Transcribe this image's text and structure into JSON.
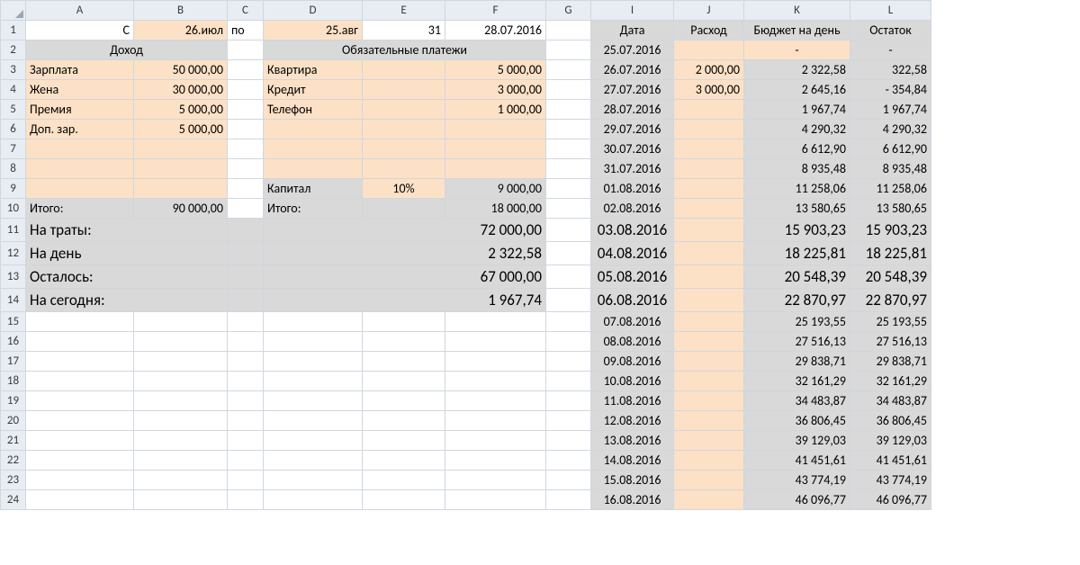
{
  "columns": [
    "A",
    "B",
    "C",
    "D",
    "E",
    "F",
    "G",
    "I",
    "J",
    "K",
    "L"
  ],
  "header": {
    "c_label": "С",
    "po_label": "по",
    "start_date": "26.июл",
    "end_date": "25.авг",
    "days": "31",
    "today": "28.07.2016",
    "date": "Дата",
    "expense": "Расход",
    "budget": "Бюджет на день",
    "balance": "Остаток"
  },
  "sections": {
    "income": "Доход",
    "payments": "Обязательные платежи"
  },
  "income": [
    {
      "name": "Зарплата",
      "value": "50 000,00"
    },
    {
      "name": "Жена",
      "value": "30 000,00"
    },
    {
      "name": "Премия",
      "value": "5 000,00"
    },
    {
      "name": "Доп. зар.",
      "value": "5 000,00"
    }
  ],
  "income_total": {
    "label": "Итого:",
    "value": "90 000,00"
  },
  "payments": [
    {
      "name": "Квартира",
      "value": "5 000,00"
    },
    {
      "name": "Кредит",
      "value": "3 000,00"
    },
    {
      "name": "Телефон",
      "value": "1 000,00"
    }
  ],
  "capital": {
    "name": "Капитал",
    "pct": "10%",
    "value": "9 000,00"
  },
  "payments_total": {
    "label": "Итого:",
    "value": "18 000,00"
  },
  "summary": [
    {
      "label": "На траты:",
      "value": "72 000,00"
    },
    {
      "label": "На день",
      "value": "2 322,58"
    },
    {
      "label": "Осталось:",
      "value": "67 000,00"
    },
    {
      "label": "На сегодня:",
      "value": "1 967,74"
    }
  ],
  "daily": [
    {
      "date": "25.07.2016",
      "exp": "",
      "budget": "-",
      "bal": "-"
    },
    {
      "date": "26.07.2016",
      "exp": "2 000,00",
      "budget": "2 322,58",
      "bal": "322,58"
    },
    {
      "date": "27.07.2016",
      "exp": "3 000,00",
      "budget": "2 645,16",
      "bal_prefix": "-",
      "bal": "354,84"
    },
    {
      "date": "28.07.2016",
      "exp": "",
      "budget": "1 967,74",
      "bal": "1 967,74"
    },
    {
      "date": "29.07.2016",
      "exp": "",
      "budget": "4 290,32",
      "bal": "4 290,32"
    },
    {
      "date": "30.07.2016",
      "exp": "",
      "budget": "6 612,90",
      "bal": "6 612,90"
    },
    {
      "date": "31.07.2016",
      "exp": "",
      "budget": "8 935,48",
      "bal": "8 935,48"
    },
    {
      "date": "01.08.2016",
      "exp": "",
      "budget": "11 258,06",
      "bal": "11 258,06"
    },
    {
      "date": "02.08.2016",
      "exp": "",
      "budget": "13 580,65",
      "bal": "13 580,65"
    },
    {
      "date": "03.08.2016",
      "exp": "",
      "budget": "15 903,23",
      "bal": "15 903,23"
    },
    {
      "date": "04.08.2016",
      "exp": "",
      "budget": "18 225,81",
      "bal": "18 225,81"
    },
    {
      "date": "05.08.2016",
      "exp": "",
      "budget": "20 548,39",
      "bal": "20 548,39"
    },
    {
      "date": "06.08.2016",
      "exp": "",
      "budget": "22 870,97",
      "bal": "22 870,97"
    },
    {
      "date": "07.08.2016",
      "exp": "",
      "budget": "25 193,55",
      "bal": "25 193,55"
    },
    {
      "date": "08.08.2016",
      "exp": "",
      "budget": "27 516,13",
      "bal": "27 516,13"
    },
    {
      "date": "09.08.2016",
      "exp": "",
      "budget": "29 838,71",
      "bal": "29 838,71"
    },
    {
      "date": "10.08.2016",
      "exp": "",
      "budget": "32 161,29",
      "bal": "32 161,29"
    },
    {
      "date": "11.08.2016",
      "exp": "",
      "budget": "34 483,87",
      "bal": "34 483,87"
    },
    {
      "date": "12.08.2016",
      "exp": "",
      "budget": "36 806,45",
      "bal": "36 806,45"
    },
    {
      "date": "13.08.2016",
      "exp": "",
      "budget": "39 129,03",
      "bal": "39 129,03"
    },
    {
      "date": "14.08.2016",
      "exp": "",
      "budget": "41 451,61",
      "bal": "41 451,61"
    },
    {
      "date": "15.08.2016",
      "exp": "",
      "budget": "43 774,19",
      "bal": "43 774,19"
    },
    {
      "date": "16.08.2016",
      "exp": "",
      "budget": "46 096,77",
      "bal": "46 096,77"
    }
  ]
}
